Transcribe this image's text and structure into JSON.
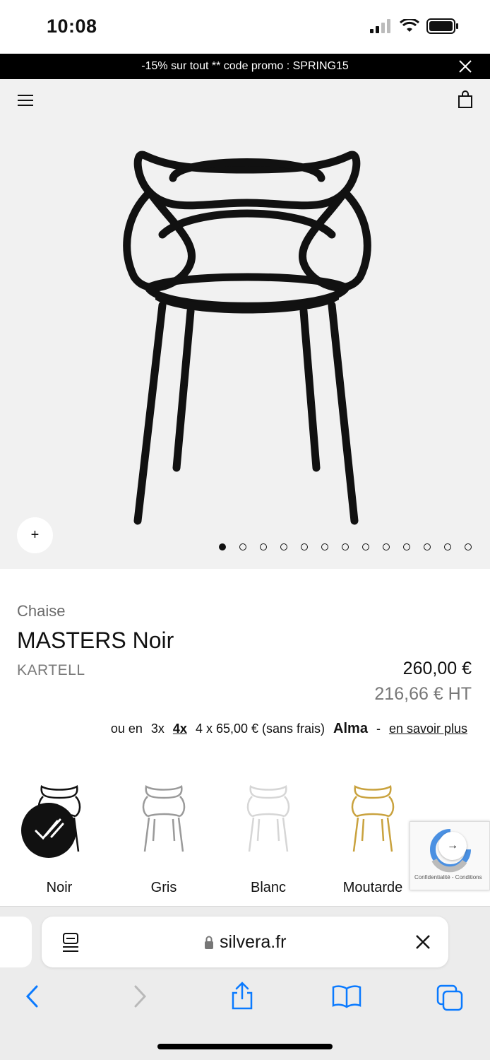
{
  "status": {
    "time": "10:08"
  },
  "promo": {
    "text": "-15% sur tout ** code promo : SPRING15"
  },
  "gallery": {
    "zoom_label": "+",
    "dot_count": 13,
    "active_dot": 0
  },
  "product": {
    "category": "Chaise",
    "title": "MASTERS Noir",
    "brand": "KARTELL",
    "price": "260,00 €",
    "price_ht": "216,66 € HT"
  },
  "alma": {
    "prefix": "ou en",
    "opt3": "3x",
    "opt4": "4x",
    "detail": "4 x 65,00 € (sans frais)",
    "logo": "Alma",
    "sep": "-",
    "link": "en savoir plus"
  },
  "swatches": [
    {
      "label": "Noir",
      "color": "#111111"
    },
    {
      "label": "Gris",
      "color": "#9a9a9a"
    },
    {
      "label": "Blanc",
      "color": "#e4e4e4"
    },
    {
      "label": "Moutarde",
      "color": "#c9a23e"
    }
  ],
  "recaptcha": {
    "text": "Confidentialité - Conditions"
  },
  "browser": {
    "url": "silvera.fr"
  },
  "colors": {
    "accent_blue": "#0a7aff"
  }
}
